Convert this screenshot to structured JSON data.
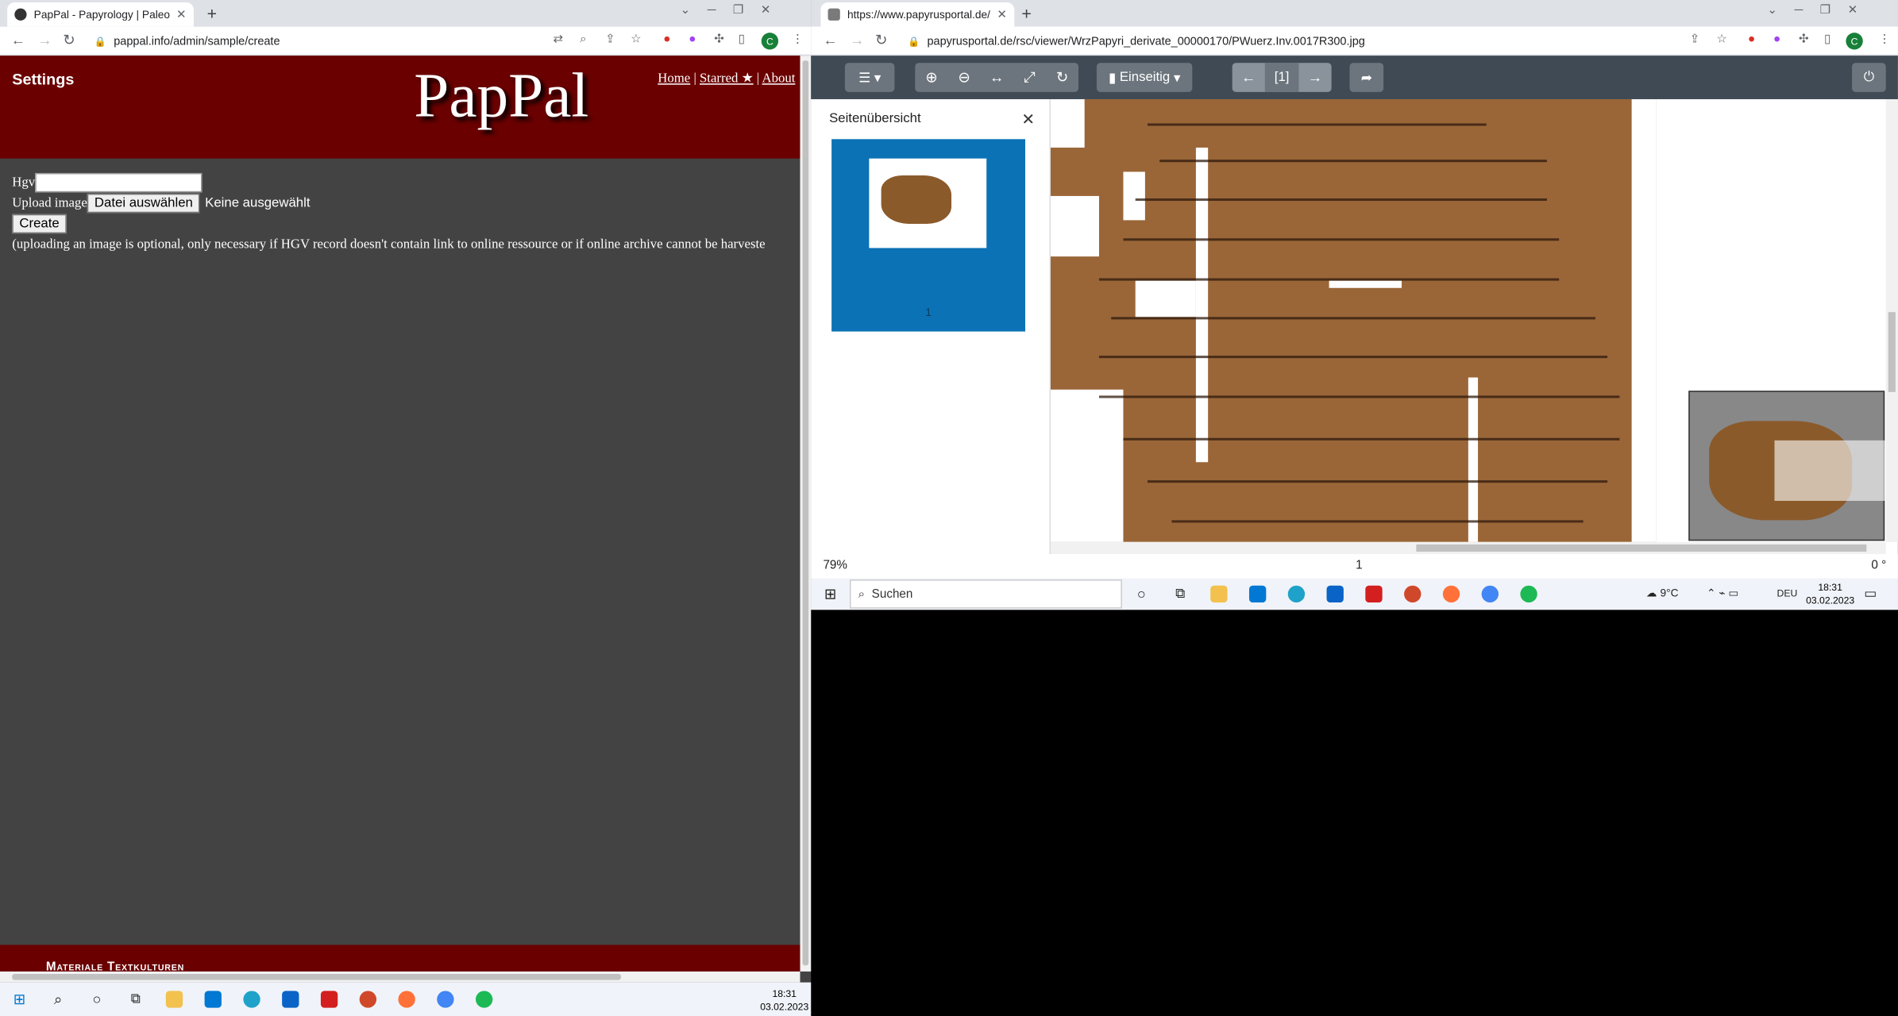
{
  "left": {
    "tab_title": "PapPal - Papyrology | Paleograph",
    "url": "pappal.info/admin/sample/create",
    "profile_letter": "C",
    "header": {
      "settings": "Settings",
      "logo": "PapPal",
      "nav": {
        "home": "Home",
        "sep1": "|",
        "starred": "Starred ★",
        "sep2": "|",
        "about": "About"
      }
    },
    "form": {
      "hgv_label": "Hgv",
      "upload_label": "Upload image",
      "file_button": "Datei auswählen",
      "no_file": "Keine ausgewählt",
      "create_button": "Create",
      "note": "(uploading an image is optional, only necessary if HGV record doesn't contain link to online ressource or if online archive cannot be harveste"
    },
    "footer": "Materiale Textkulturen",
    "taskbar": {
      "time": "18:31",
      "date": "03.02.2023"
    }
  },
  "right": {
    "tab_title": "https://www.papyrusportal.de/rs",
    "url": "papyrusportal.de/rsc/viewer/WrzPapyri_derivate_00000170/PWuerz.Inv.0017R300.jpg",
    "profile_letter": "C",
    "viewer": {
      "view_mode": "Einseitig",
      "page_indicator": "[1]",
      "side_title": "Seitenübersicht",
      "thumb_page": "1",
      "zoom": "79%",
      "page": "1",
      "rotation": "0 °"
    },
    "taskbar": {
      "search_placeholder": "Suchen",
      "weather": "9°C",
      "lang": "DEU",
      "time": "18:31",
      "date": "03.02.2023"
    }
  },
  "colors": {
    "pappal_red": "#6b0000",
    "page_gray": "#434343",
    "viewer_bar": "#3f4a55",
    "thumb_blue": "#0b72b5",
    "papyrus": "#9a6638"
  }
}
